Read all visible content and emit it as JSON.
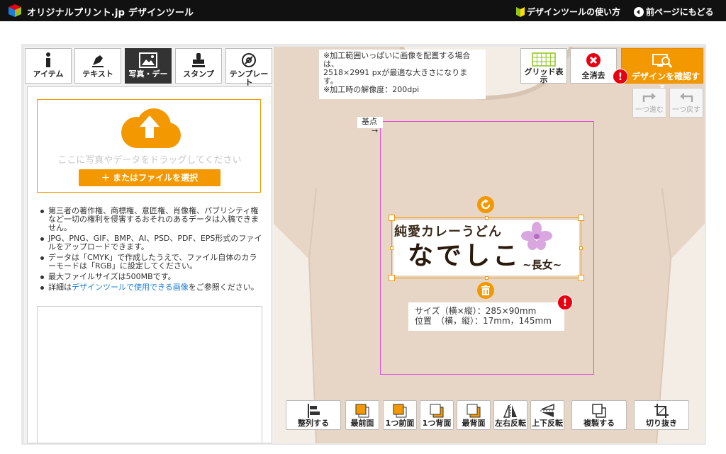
{
  "header": {
    "brand": "オリジナルプリント.jp デザインツール",
    "guide_link": "デザインツールの使い方",
    "back_link": "前ページにもどる"
  },
  "tabs": [
    {
      "label": "アイテム",
      "icon": "info-icon"
    },
    {
      "label": "テキスト",
      "icon": "pen-icon"
    },
    {
      "label": "写真・デー",
      "icon": "image-icon"
    },
    {
      "label": "スタンプ",
      "icon": "stamp-icon"
    },
    {
      "label": "テンプレー\nト",
      "icon": "template-icon"
    }
  ],
  "upload": {
    "drop_text": "ここに写真やデータをドラッグしてください",
    "file_button": "＋ またはファイルを選択"
  },
  "notes": [
    "第三者の著作権、商標権、意匠権、肖像権、パブリシティ権など一切の権利を侵害するおそれのあるデータは入稿できません。",
    "JPG、PNG、GIF、BMP、AI、PSD、PDF、EPS形式のファイルをアップロードできます。",
    "データは「CMYK」で作成したうえで、ファイル自体のカラーモードは「RGB」に設定してください。",
    "最大ファイルサイズは500MBです。"
  ],
  "note_detail": {
    "prefix": "詳細は",
    "link": "デザインツールで使用できる画像",
    "suffix": "をご参照ください。"
  },
  "canvas": {
    "info_note": "※加工範囲いっぱいに画像を配置する場合は、\n2518×2991 pxが最適な大きさになります。\n※加工時の解像度：200dpi",
    "origin_label": "基点",
    "origin_arrow": "→",
    "artwork": {
      "line1": "純愛カレーうどん",
      "line2": "なでしこ",
      "line3": "~長女~"
    },
    "size_label": "サイズ（横×縦）：285×90mm",
    "position_label": "位置　（横，縦）：17mm，145mm"
  },
  "tools": {
    "grid": "グリッド表示",
    "clear": "全消去",
    "confirm": "デザインを確認する",
    "redo": "一つ進む",
    "undo": "一つ戻す",
    "warning_mark": "!"
  },
  "bottom_tools": [
    {
      "label": "整列する",
      "icon": "align-icon"
    },
    {
      "label": "最前面",
      "icon": "bring-front-icon"
    },
    {
      "label": "1つ前面",
      "icon": "bring-forward-icon"
    },
    {
      "label": "1つ背面",
      "icon": "send-backward-icon"
    },
    {
      "label": "最背面",
      "icon": "send-back-icon"
    },
    {
      "label": "左右反転",
      "icon": "flip-horizontal-icon"
    },
    {
      "label": "上下反転",
      "icon": "flip-vertical-icon"
    },
    {
      "label": "複製する",
      "icon": "duplicate-icon"
    },
    {
      "label": "切り抜き",
      "icon": "crop-icon"
    }
  ],
  "colors": {
    "accent": "#f39800",
    "warning": "#e60012",
    "shirt": "#e7d6c6",
    "print_area": "#e04ce0"
  }
}
